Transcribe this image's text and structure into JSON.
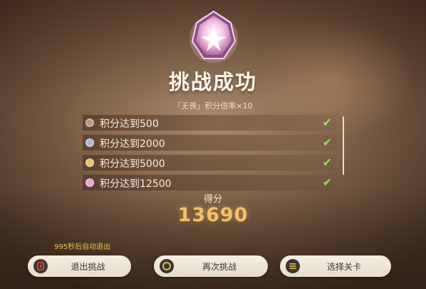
{
  "result": {
    "title": "挑战成功",
    "subtitle": "「无畏」积分倍率×10"
  },
  "objectives": [
    {
      "label": "积分达到500",
      "gem_color": "#b59a8c",
      "done": true
    },
    {
      "label": "积分达到2000",
      "gem_color": "#aeb8d6",
      "done": true
    },
    {
      "label": "积分达到5000",
      "gem_color": "#e6c46a",
      "done": true
    },
    {
      "label": "积分达到12500",
      "gem_color": "#e4a7d3",
      "done": true
    }
  ],
  "score": {
    "label": "得分",
    "value": "13690"
  },
  "auto_exit": "995秒后自动退出",
  "buttons": {
    "exit": "退出挑战",
    "retry": "再次挑战",
    "select": "选择关卡"
  },
  "colors": {
    "check": "#8fe36a",
    "score": "#f3c16a",
    "countdown": "#f0bf58"
  },
  "icons": {
    "emblem": "pink-star-crystal",
    "check": "checkmark",
    "exit": "exit-door",
    "retry": "circle",
    "select": "menu-list"
  }
}
